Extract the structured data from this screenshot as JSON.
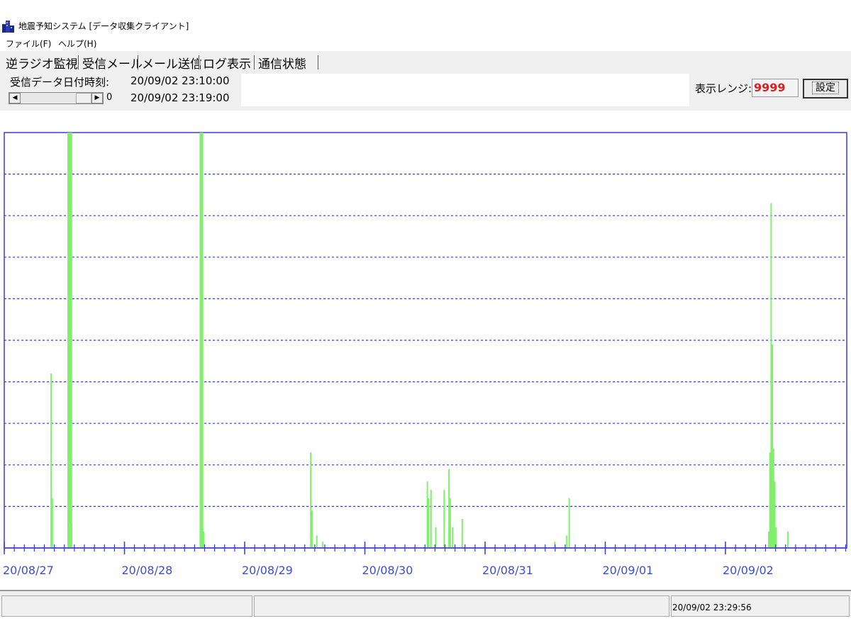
{
  "window": {
    "title": "地震予知システム [データ収集クライアント]",
    "icon": "app-buildings-icon"
  },
  "menu": {
    "items": [
      "ファイル(F)",
      "ヘルプ(H)"
    ]
  },
  "tabs": [
    {
      "label": "逆ラジオ監視",
      "active": true
    },
    {
      "label": "受信メール",
      "active": false
    },
    {
      "label": "メール送信",
      "active": false
    },
    {
      "label": "ログ表示",
      "active": false
    },
    {
      "label": "通信状態",
      "active": false
    }
  ],
  "info": {
    "received_label": "受信データ日付時刻:",
    "received_start": "20/09/02 23:10:00",
    "received_end": "20/09/02 23:19:00",
    "scroll_value": "0",
    "range_label": "表示レンジ:",
    "range_value": "9999",
    "set_button": "設定"
  },
  "status": {
    "time": "20/09/02 23:29:56"
  },
  "colors": {
    "axis": "#3b3bd6",
    "bars": "#7ef06a",
    "tick_label": "#3b4fd6",
    "range_value": "#e02020"
  },
  "chart_data": {
    "type": "bar",
    "title": "",
    "xlabel": "",
    "ylabel": "",
    "x_ticks": [
      "20/08/27",
      "20/08/28",
      "20/08/29",
      "20/08/30",
      "20/08/31",
      "20/09/01",
      "20/09/02"
    ],
    "ylim": [
      0,
      10
    ],
    "grid": "horizontal-dashed",
    "series": [
      {
        "days": [
          0.39,
          0.4,
          0.54,
          0.55,
          0.56,
          1.64,
          1.65,
          1.66,
          2.55,
          2.56,
          2.6,
          2.65,
          3.52,
          3.53,
          3.55,
          3.59,
          3.66,
          3.7,
          3.71,
          3.73,
          3.81,
          4.58,
          4.68,
          4.7,
          6.36,
          6.37,
          6.38,
          6.39,
          6.4,
          6.41,
          6.42,
          6.52
        ],
        "values": [
          4.2,
          1.2,
          10.0,
          10.0,
          0.6,
          10.0,
          7.0,
          0.4,
          2.3,
          0.9,
          0.3,
          0.15,
          1.6,
          1.2,
          1.4,
          0.5,
          1.4,
          1.9,
          1.2,
          0.5,
          0.7,
          0.15,
          0.3,
          1.2,
          0.4,
          2.3,
          8.3,
          4.9,
          2.4,
          1.6,
          0.5,
          0.4
        ]
      }
    ]
  }
}
